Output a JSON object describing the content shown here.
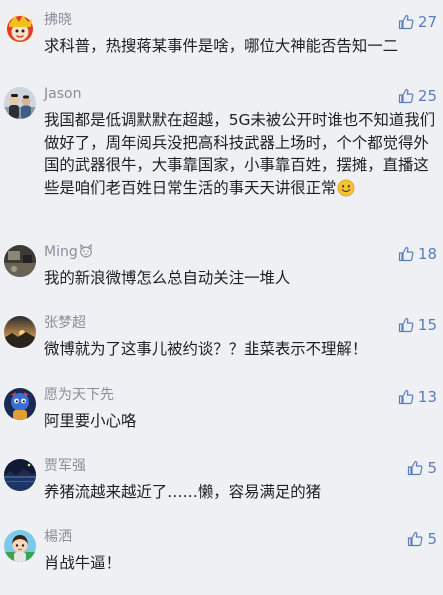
{
  "comments": [
    {
      "name": "拂晓",
      "likes": "27",
      "text": "求科普，热搜蒋某事件是啥，哪位大神能否告知一二",
      "avatar": "cartoon-face-avatar"
    },
    {
      "name": "Jason",
      "likes": "25",
      "text": "我国都是低调默默在超越，5G未被公开时谁也不知道我们做好了，周年阅兵没把高科技武器上场时，个个都觉得外国的武器很牛，大事靠国家，小事靠百姓，摆摊，直播这些是咱们老百姓日常生活的事天天讲很正常",
      "trailing_icon": "smiling-face-emoji",
      "avatar": "people-photo-avatar"
    },
    {
      "name": "Ming",
      "name_icon": "cat-face-emoji",
      "likes": "18",
      "text": "我的新浪微博怎么总自动关注一堆人",
      "avatar": "dark-room-photo-avatar"
    },
    {
      "name": "张梦超",
      "likes": "15",
      "text": "微博就为了这事儿被约谈？？韭菜表示不理解！",
      "avatar": "sunset-landscape-avatar"
    },
    {
      "name": "愿为天下先",
      "likes": "13",
      "text": "阿里要小心咯",
      "avatar": "blue-character-avatar"
    },
    {
      "name": "贾军强",
      "likes": "5",
      "text": "养猪流越来越近了……懒，容易满足的猪",
      "avatar": "night-lake-avatar"
    },
    {
      "name": "楊洒",
      "likes": "5",
      "text": "肖战牛逼！",
      "avatar": "anime-character-avatar"
    }
  ],
  "colors": {
    "background": "#eff0f4",
    "name": "#8a8e99",
    "like": "#5a7fb8",
    "text": "#1f1f1f"
  },
  "icons": {
    "like": "thumbs-up-icon"
  }
}
